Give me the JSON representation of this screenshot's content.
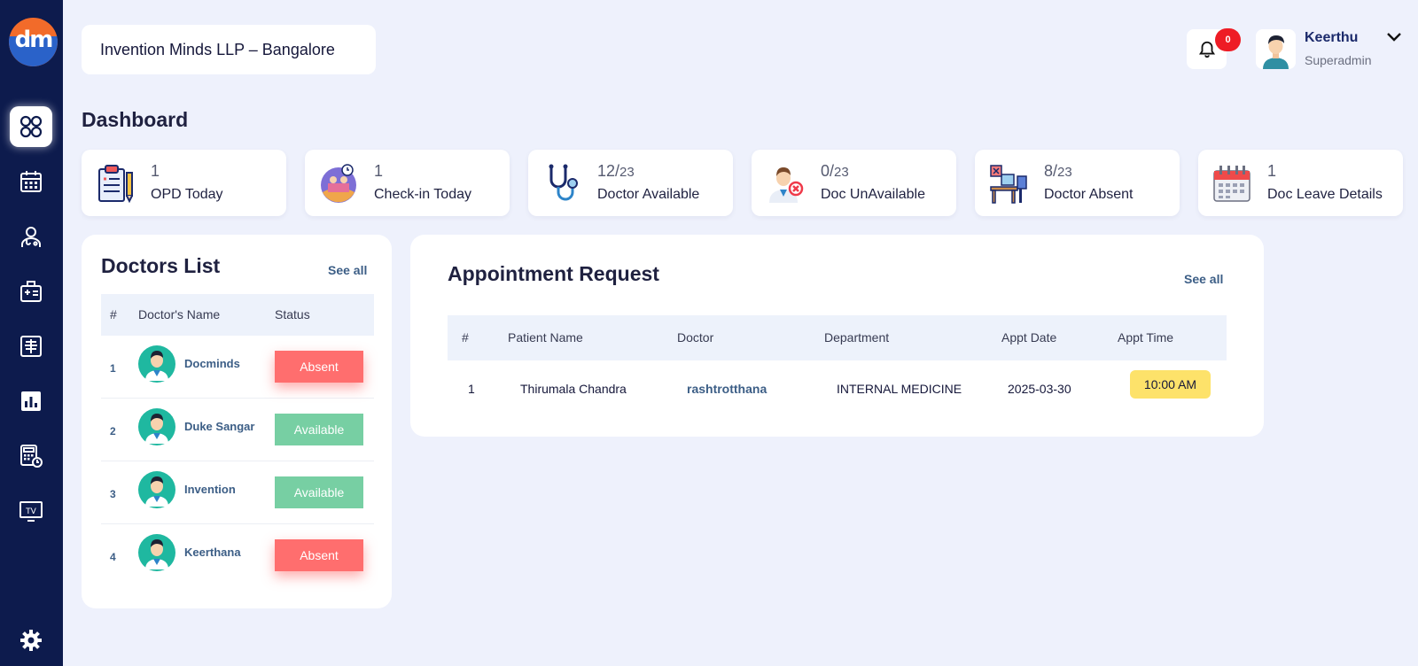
{
  "header": {
    "company": "Invention Minds LLP – Bangalore",
    "notification_count": "0",
    "user_name": "Keerthu",
    "user_role": "Superadmin"
  },
  "logo_text": "dm",
  "page_title": "Dashboard",
  "sidebar": {
    "items": [
      {
        "name": "dashboard-icon"
      },
      {
        "name": "calendar-icon"
      },
      {
        "name": "doctor-icon"
      },
      {
        "name": "medical-id-icon"
      },
      {
        "name": "xray-icon"
      },
      {
        "name": "bar-chart-icon"
      },
      {
        "name": "billing-clock-icon"
      },
      {
        "name": "tv-icon"
      },
      {
        "name": "settings-icon"
      }
    ],
    "tv_label": "TV"
  },
  "stats": [
    {
      "num": "1",
      "den": "",
      "label": "OPD Today",
      "icon": "clipboard-icon"
    },
    {
      "num": "1",
      "den": "",
      "label": "Check-in Today",
      "icon": "checkin-icon"
    },
    {
      "num": "12/",
      "den": "23",
      "label": "Doctor Available",
      "icon": "stethoscope-icon"
    },
    {
      "num": "0/",
      "den": "23",
      "label": "Doc UnAvailable",
      "icon": "doctor-unavailable-icon"
    },
    {
      "num": "8/",
      "den": "23",
      "label": "Doctor Absent",
      "icon": "empty-desk-icon"
    },
    {
      "num": "1",
      "den": "",
      "label": "Doc Leave Details",
      "icon": "calendar-leave-icon"
    }
  ],
  "doctors_list": {
    "title": "Doctors List",
    "see_all": "See all",
    "columns": [
      "#",
      "Doctor's Name",
      "Status"
    ],
    "rows": [
      {
        "num": "1",
        "name": "Docminds",
        "status": "Absent"
      },
      {
        "num": "2",
        "name": "Duke Sangar",
        "status": "Available"
      },
      {
        "num": "3",
        "name": "Invention",
        "status": "Available"
      },
      {
        "num": "4",
        "name": "Keerthana",
        "status": "Absent"
      }
    ]
  },
  "appointments": {
    "title": "Appointment Request",
    "see_all": "See all",
    "columns": [
      "#",
      "Patient Name",
      "Doctor",
      "Department",
      "Appt Date",
      "Appt Time"
    ],
    "rows": [
      {
        "num": "1",
        "patient": "Thirumala Chandra",
        "doctor": "rashtrotthana",
        "department": "INTERNAL MEDICINE",
        "date": "2025-03-30",
        "time": "10:00 AM"
      }
    ]
  },
  "colors": {
    "sidebar": "#0d1b4d",
    "absent": "#ff6e6e",
    "available": "#77cfa3",
    "time_pill": "#fde26a",
    "badge": "#ee1c25"
  }
}
